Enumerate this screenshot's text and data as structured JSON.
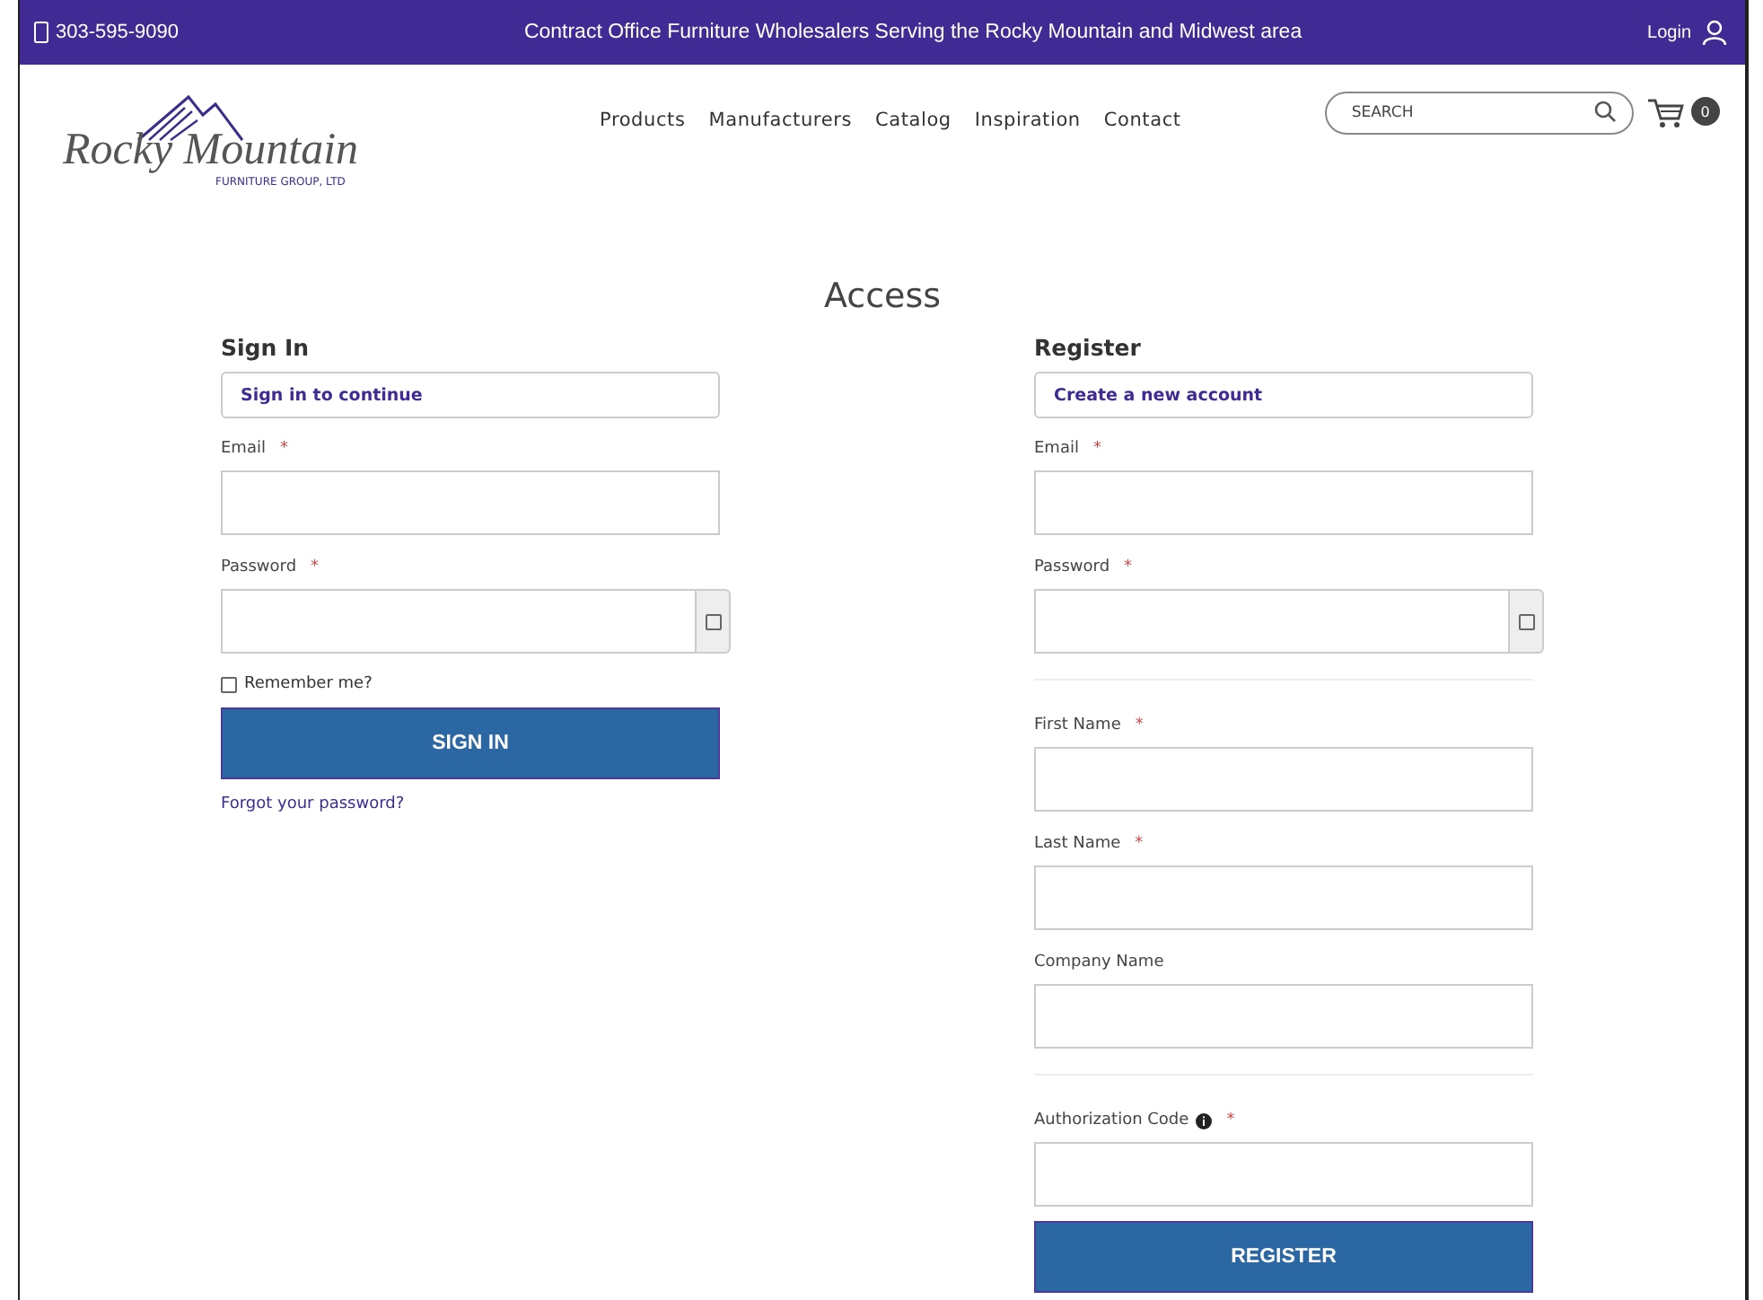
{
  "top_bar": {
    "phone": "303-595-9090",
    "tagline": "Contract Office Furniture Wholesalers Serving the Rocky Mountain and Midwest area",
    "login": "Login"
  },
  "header": {
    "logo_name": "Rocky Mountain",
    "logo_sub": "FURNITURE GROUP, LTD",
    "nav": [
      "Products",
      "Manufacturers",
      "Catalog",
      "Inspiration",
      "Contact"
    ],
    "search": {
      "placeholder": "SEARCH"
    },
    "cart_count": "0"
  },
  "page_title": "Access",
  "sign_in": {
    "heading": "Sign In",
    "notice": "Sign in to continue",
    "items": [
      {
        "kind": "text",
        "label": "Email",
        "required_mark": "*"
      },
      {
        "kind": "password",
        "label": "Password",
        "required_mark": "*"
      },
      {
        "kind": "checkbox",
        "label": "Remember me?",
        "checked": false
      }
    ],
    "button": "SIGN IN",
    "link": "Forgot your password?"
  },
  "register": {
    "heading": "Register",
    "notice": "Create a new account",
    "items": [
      {
        "kind": "text",
        "label": "Email",
        "required_mark": "*"
      },
      {
        "kind": "password",
        "label": "Password",
        "required_mark": "*"
      },
      {
        "kind": "divider"
      },
      {
        "kind": "text",
        "label": "First Name",
        "required_mark": "*"
      },
      {
        "kind": "text",
        "label": "Last Name",
        "required_mark": "*"
      },
      {
        "kind": "text",
        "label": "Company Name"
      },
      {
        "kind": "divider"
      },
      {
        "kind": "info",
        "label": "Authorization Code",
        "required_mark": "*"
      }
    ],
    "button": "REGISTER"
  }
}
